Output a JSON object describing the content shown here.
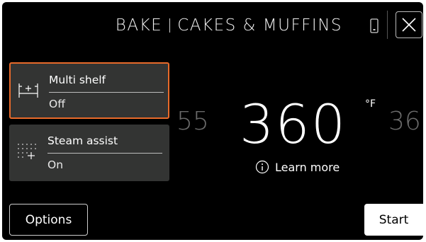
{
  "header": {
    "mode": "BAKE",
    "recipe": "CAKES & MUFFINS",
    "icons": {
      "phone": "phone-icon",
      "close": "close-icon"
    }
  },
  "cards": [
    {
      "title": "Multi shelf",
      "value": "Off",
      "icon": "multi-shelf-icon",
      "selected": true
    },
    {
      "title": "Steam assist",
      "value": "On",
      "icon": "steam-assist-icon",
      "selected": false
    }
  ],
  "temperature": {
    "previous": "55",
    "current": "360",
    "unit": "°F",
    "next": "36"
  },
  "learn_more": {
    "label": "Learn more",
    "icon": "info-icon"
  },
  "footer": {
    "options_label": "Options",
    "start_label": "Start"
  },
  "colors": {
    "background": "#000000",
    "card": "#333433",
    "selected_border": "#e86a2a",
    "faded_text": "#6a6a6a"
  }
}
